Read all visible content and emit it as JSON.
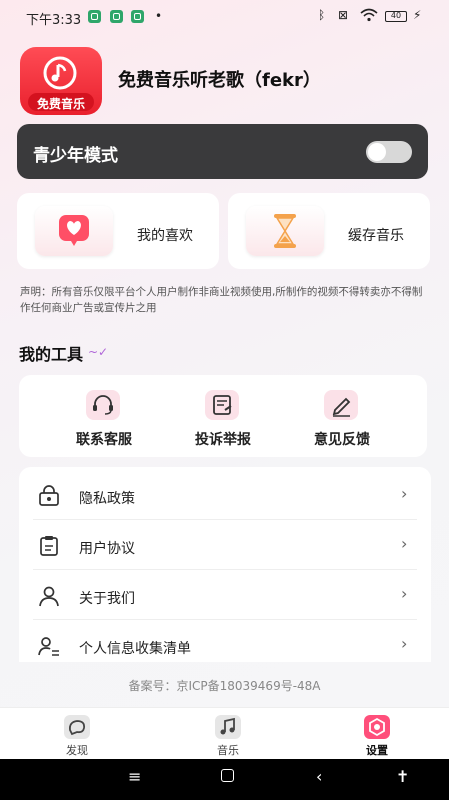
{
  "status_bar": {
    "time": "下午3:33",
    "battery": "40"
  },
  "app": {
    "logo_text": "免费音乐",
    "title": "免费音乐听老歌（fekr）"
  },
  "youth_mode": {
    "label": "青少年模式",
    "enabled": false
  },
  "quick_cards": [
    {
      "label": "我的喜欢",
      "icon": "heart-icon"
    },
    {
      "label": "缓存音乐",
      "icon": "hourglass-icon"
    }
  ],
  "notice": "声明：所有音乐仅限平台个人用户制作非商业视频使用,所制作的视频不得转卖亦不得制作任何商业广告或宣传片之用",
  "tools": {
    "title": "我的工具",
    "items": [
      {
        "label": "联系客服",
        "icon": "headset-icon"
      },
      {
        "label": "投诉举报",
        "icon": "report-icon"
      },
      {
        "label": "意见反馈",
        "icon": "edit-icon"
      }
    ]
  },
  "settings_list": [
    {
      "label": "隐私政策",
      "icon": "lock-icon"
    },
    {
      "label": "用户协议",
      "icon": "clipboard-icon"
    },
    {
      "label": "关于我们",
      "icon": "user-icon"
    },
    {
      "label": "个人信息收集清单",
      "icon": "user-list-icon"
    }
  ],
  "icp": "备案号：京ICP备18039469号-48A",
  "tab_bar": [
    {
      "label": "发现",
      "icon": "discover-icon",
      "active": false
    },
    {
      "label": "音乐",
      "icon": "music-note-icon",
      "active": false
    },
    {
      "label": "设置",
      "icon": "settings-icon",
      "active": true
    }
  ],
  "colors": {
    "accent": "#e9202d",
    "youth_bg": "#3a3a3c",
    "active_tab": "#ff4f7b"
  }
}
